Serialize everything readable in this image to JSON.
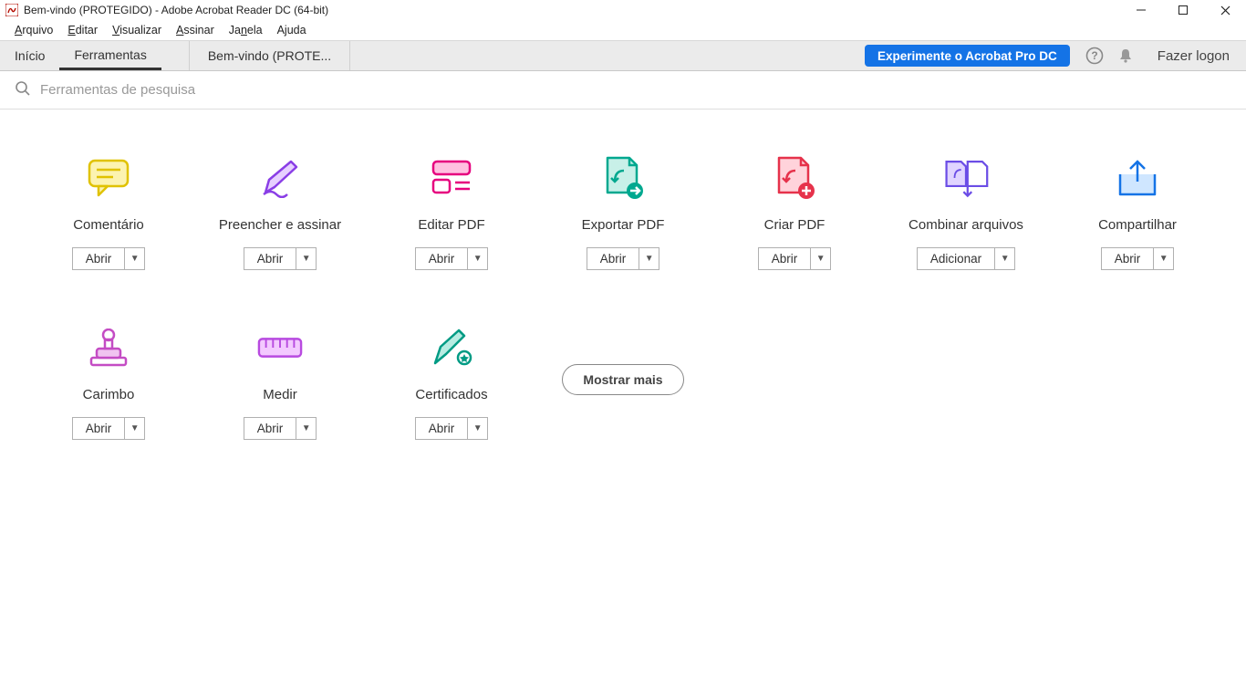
{
  "window": {
    "title": "Bem-vindo (PROTEGIDO) - Adobe Acrobat Reader DC (64-bit)"
  },
  "menu": {
    "items": [
      "Arquivo",
      "Editar",
      "Visualizar",
      "Assinar",
      "Janela",
      "Ajuda"
    ]
  },
  "header": {
    "tabs": {
      "home": "Início",
      "tools": "Ferramentas"
    },
    "doc_tab": "Bem-vindo (PROTE...",
    "promo": "Experimente o Acrobat Pro DC",
    "login": "Fazer logon"
  },
  "search": {
    "placeholder": "Ferramentas de pesquisa"
  },
  "tools": [
    {
      "label": "Comentário",
      "button": "Abrir"
    },
    {
      "label": "Preencher e assinar",
      "button": "Abrir"
    },
    {
      "label": "Editar PDF",
      "button": "Abrir"
    },
    {
      "label": "Exportar PDF",
      "button": "Abrir"
    },
    {
      "label": "Criar PDF",
      "button": "Abrir"
    },
    {
      "label": "Combinar arquivos",
      "button": "Adicionar"
    },
    {
      "label": "Compartilhar",
      "button": "Abrir"
    },
    {
      "label": "Carimbo",
      "button": "Abrir"
    },
    {
      "label": "Medir",
      "button": "Abrir"
    },
    {
      "label": "Certificados",
      "button": "Abrir"
    }
  ],
  "show_more": "Mostrar mais"
}
